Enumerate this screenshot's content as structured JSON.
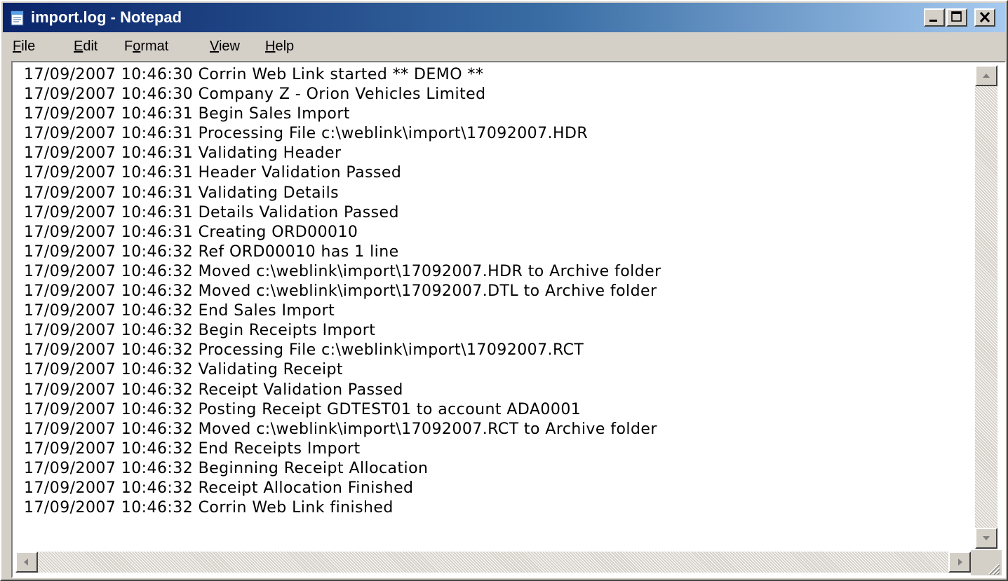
{
  "window": {
    "title": "import.log - Notepad",
    "icon": "notepad-icon",
    "controls": [
      "minimize-icon",
      "maximize-icon",
      "close-icon"
    ]
  },
  "menu": {
    "items": [
      {
        "label": "File",
        "mnemonic": "F"
      },
      {
        "label": "Edit",
        "mnemonic": "E"
      },
      {
        "label": "Format",
        "mnemonic": "o"
      },
      {
        "label": "View",
        "mnemonic": "V"
      },
      {
        "label": "Help",
        "mnemonic": "H"
      }
    ]
  },
  "document": {
    "lines": [
      "17/09/2007 10:46:30 Corrin Web Link started ** DEMO **",
      "17/09/2007 10:46:30 Company Z - Orion Vehicles Limited",
      "17/09/2007 10:46:31 Begin Sales Import",
      "17/09/2007 10:46:31 Processing File c:\\weblink\\import\\17092007.HDR",
      "17/09/2007 10:46:31 Validating Header",
      "17/09/2007 10:46:31 Header Validation Passed",
      "17/09/2007 10:46:31 Validating Details",
      "17/09/2007 10:46:31 Details Validation Passed",
      "17/09/2007 10:46:31 Creating ORD00010",
      "17/09/2007 10:46:32 Ref ORD00010 has 1 line",
      "17/09/2007 10:46:32 Moved c:\\weblink\\import\\17092007.HDR to Archive folder",
      "17/09/2007 10:46:32 Moved c:\\weblink\\import\\17092007.DTL to Archive folder",
      "17/09/2007 10:46:32 End Sales Import",
      "17/09/2007 10:46:32 Begin Receipts Import",
      "17/09/2007 10:46:32 Processing File c:\\weblink\\import\\17092007.RCT",
      "17/09/2007 10:46:32 Validating Receipt",
      "17/09/2007 10:46:32 Receipt Validation Passed",
      "17/09/2007 10:46:32 Posting Receipt GDTEST01 to account ADA0001",
      "17/09/2007 10:46:32 Moved c:\\weblink\\import\\17092007.RCT to Archive folder",
      "17/09/2007 10:46:32 End Receipts Import",
      "17/09/2007 10:46:32 Beginning Receipt Allocation",
      "17/09/2007 10:46:32 Receipt Allocation Finished",
      "17/09/2007 10:46:32 Corrin Web Link finished"
    ]
  },
  "colors": {
    "title_active_start": "#0a246a",
    "title_active_end": "#a6caf0",
    "face": "#d4d0c8",
    "text": "#000000",
    "editor_bg": "#ffffff"
  }
}
